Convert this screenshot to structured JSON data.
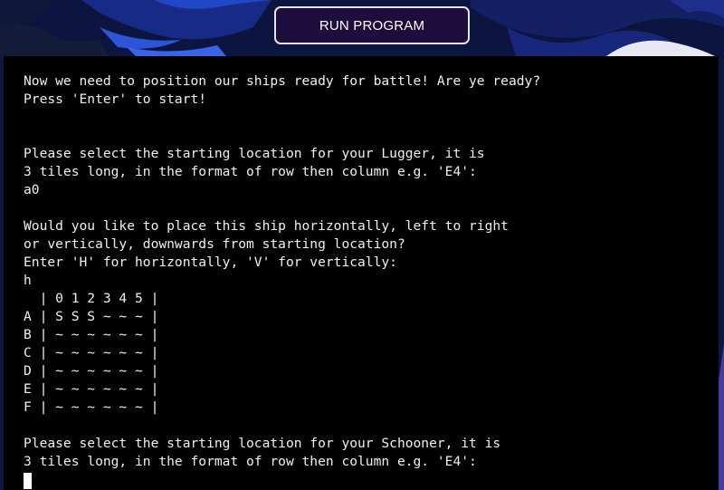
{
  "run_button": {
    "label": "RUN PROGRAM"
  },
  "terminal": {
    "lines": [
      "Now we need to position our ships ready for battle! Are ye ready?",
      "Press 'Enter' to start!",
      "",
      "",
      "Please select the starting location for your Lugger, it is",
      "3 tiles long, in the format of row then column e.g. 'E4':",
      "a0",
      "",
      "Would you like to place this ship horizontally, left to right",
      "or vertically, downwards from starting location?",
      "Enter 'H' for horizontally, 'V' for vertically:",
      "h",
      "  | 0 1 2 3 4 5 |",
      "A | S S S ~ ~ ~ |",
      "B | ~ ~ ~ ~ ~ ~ |",
      "C | ~ ~ ~ ~ ~ ~ |",
      "D | ~ ~ ~ ~ ~ ~ |",
      "E | ~ ~ ~ ~ ~ ~ |",
      "F | ~ ~ ~ ~ ~ ~ |",
      "",
      "Please select the starting location for your Schooner, it is",
      "3 tiles long, in the format of row then column e.g. 'E4':"
    ]
  },
  "colors": {
    "terminal_bg": "#000000",
    "terminal_text": "#f0f0f0",
    "button_bg": "#1d0d3c",
    "button_border": "#e6e6f2",
    "page_accent": "#2d55d8"
  }
}
